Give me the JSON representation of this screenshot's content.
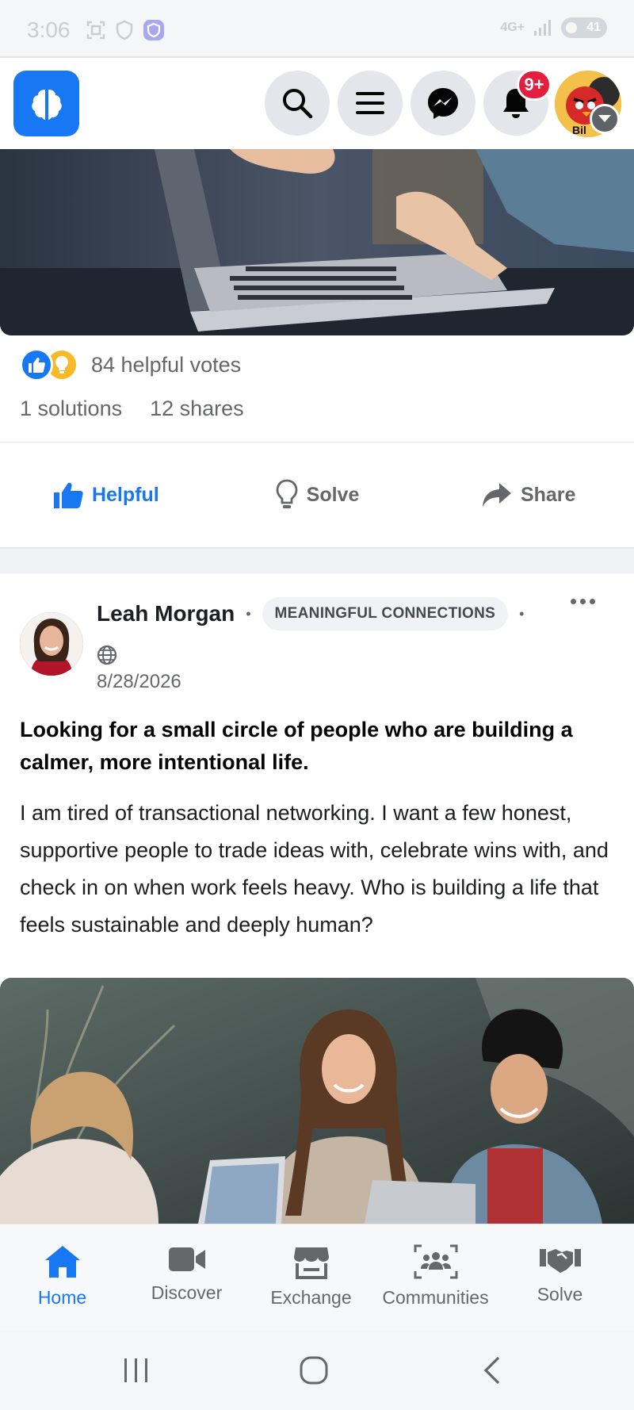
{
  "status_bar": {
    "time": "3:06",
    "network": "4G+",
    "battery": "41",
    "icons": [
      "screenshot-icon",
      "shield-icon",
      "vpn-icon",
      "signal-icon",
      "battery-icon"
    ]
  },
  "top_bar": {
    "logo_icon": "brain-logo-icon",
    "notification_badge": "9+",
    "profile_label": "Bil",
    "icons": [
      "search-icon",
      "menu-icon",
      "messenger-icon",
      "bell-icon",
      "chevron-down-icon"
    ]
  },
  "post1": {
    "votes_text": "84 helpful votes",
    "solutions_text": "1 solutions",
    "shares_text": "12 shares",
    "actions": {
      "helpful": "Helpful",
      "solve": "Solve",
      "share": "Share"
    }
  },
  "post2": {
    "author": "Leah Morgan",
    "community": "MEANINGFUL CONNECTIONS",
    "date": "8/28/2026",
    "title": "Looking for a small circle of people who are building a calmer, more intentional life.",
    "body": "I am tired of transactional networking. I want a few honest, supportive people to trade ideas with, celebrate wins with, and check in on when work feels heavy. Who is building a life that feels sustainable and deeply human?"
  },
  "bottom_nav": {
    "items": [
      {
        "label": "Home",
        "icon": "home-icon",
        "active": true
      },
      {
        "label": "Discover",
        "icon": "video-icon",
        "active": false
      },
      {
        "label": "Exchange",
        "icon": "store-icon",
        "active": false
      },
      {
        "label": "Communities",
        "icon": "group-icon",
        "active": false
      },
      {
        "label": "Solve",
        "icon": "handshake-icon",
        "active": false
      }
    ]
  },
  "colors": {
    "accent": "#1877f2",
    "badge": "#e41e3f",
    "muted_text": "#65676b"
  }
}
